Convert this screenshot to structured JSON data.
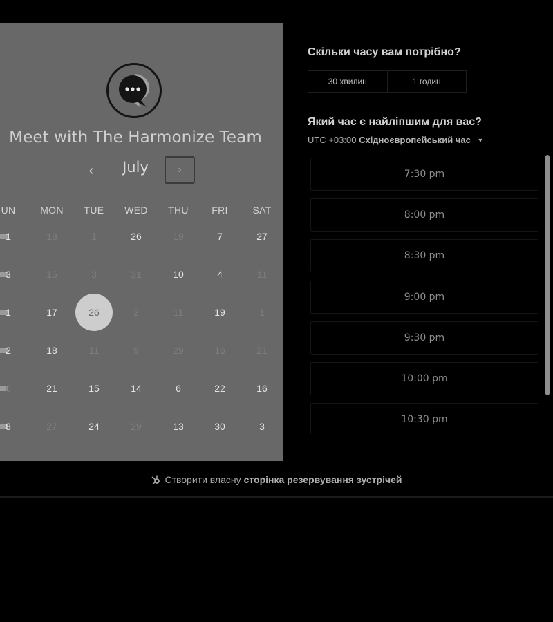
{
  "calendar": {
    "title": "Meet with The Harmonize Team",
    "month": "July",
    "prev_label": "‹",
    "next_label": "›",
    "weekdays": [
      "UN",
      "MON",
      "TUE",
      "WED",
      "THU",
      "FRI",
      "SAT"
    ],
    "weeks": [
      [
        {
          "d": "1",
          "s": "avail"
        },
        {
          "d": "18",
          "s": "dim"
        },
        {
          "d": "1",
          "s": "dim"
        },
        {
          "d": "26",
          "s": "avail"
        },
        {
          "d": "19",
          "s": "dim"
        },
        {
          "d": "7",
          "s": "avail"
        },
        {
          "d": "27",
          "s": "avail"
        }
      ],
      [
        {
          "d": "3",
          "s": "avail"
        },
        {
          "d": "15",
          "s": "dim"
        },
        {
          "d": "3",
          "s": "dim"
        },
        {
          "d": "31",
          "s": "dim"
        },
        {
          "d": "10",
          "s": "avail"
        },
        {
          "d": "4",
          "s": "avail"
        },
        {
          "d": "11",
          "s": "dim"
        }
      ],
      [
        {
          "d": "1",
          "s": "avail"
        },
        {
          "d": "17",
          "s": "avail"
        },
        {
          "d": "26",
          "s": "sel"
        },
        {
          "d": "2",
          "s": "dim"
        },
        {
          "d": "11",
          "s": "dim"
        },
        {
          "d": "19",
          "s": "avail"
        },
        {
          "d": "1",
          "s": "dim"
        }
      ],
      [
        {
          "d": "2",
          "s": "avail"
        },
        {
          "d": "18",
          "s": "avail"
        },
        {
          "d": "11",
          "s": "dim"
        },
        {
          "d": "9",
          "s": "dim"
        },
        {
          "d": "29",
          "s": "dim"
        },
        {
          "d": "16",
          "s": "dim"
        },
        {
          "d": "21",
          "s": "dim"
        }
      ],
      [
        {
          "d": "6",
          "s": "dim"
        },
        {
          "d": "21",
          "s": "avail"
        },
        {
          "d": "15",
          "s": "avail"
        },
        {
          "d": "14",
          "s": "avail"
        },
        {
          "d": "6",
          "s": "avail"
        },
        {
          "d": "22",
          "s": "avail"
        },
        {
          "d": "16",
          "s": "avail"
        }
      ],
      [
        {
          "d": "8",
          "s": "avail"
        },
        {
          "d": "27",
          "s": "dim"
        },
        {
          "d": "24",
          "s": "avail"
        },
        {
          "d": "29",
          "s": "dim"
        },
        {
          "d": "13",
          "s": "avail"
        },
        {
          "d": "30",
          "s": "avail"
        },
        {
          "d": "3",
          "s": "avail"
        }
      ]
    ],
    "selected_date": "26"
  },
  "booking": {
    "duration_question": "Скільки часу вам потрібно?",
    "durations": [
      "30 хвилин",
      "1 годин"
    ],
    "time_question": "Який час є найліпшим для вас?",
    "timezone_offset": "UTC +03:00",
    "timezone_name": "Східноєвропейський час",
    "time_slots": [
      "7:30 pm",
      "8:00 pm",
      "8:30 pm",
      "9:00 pm",
      "9:30 pm",
      "10:00 pm",
      "10:30 pm"
    ]
  },
  "footer": {
    "prefix": "Створити власну",
    "link": "сторінка резервування зустрічей"
  },
  "icons": {
    "logo": "chat-bubble-icon",
    "brand": "hubspot-sprocket-icon"
  },
  "colors": {
    "panel": "#686868",
    "background": "#000000",
    "selected_day": "#cdcdcd"
  }
}
